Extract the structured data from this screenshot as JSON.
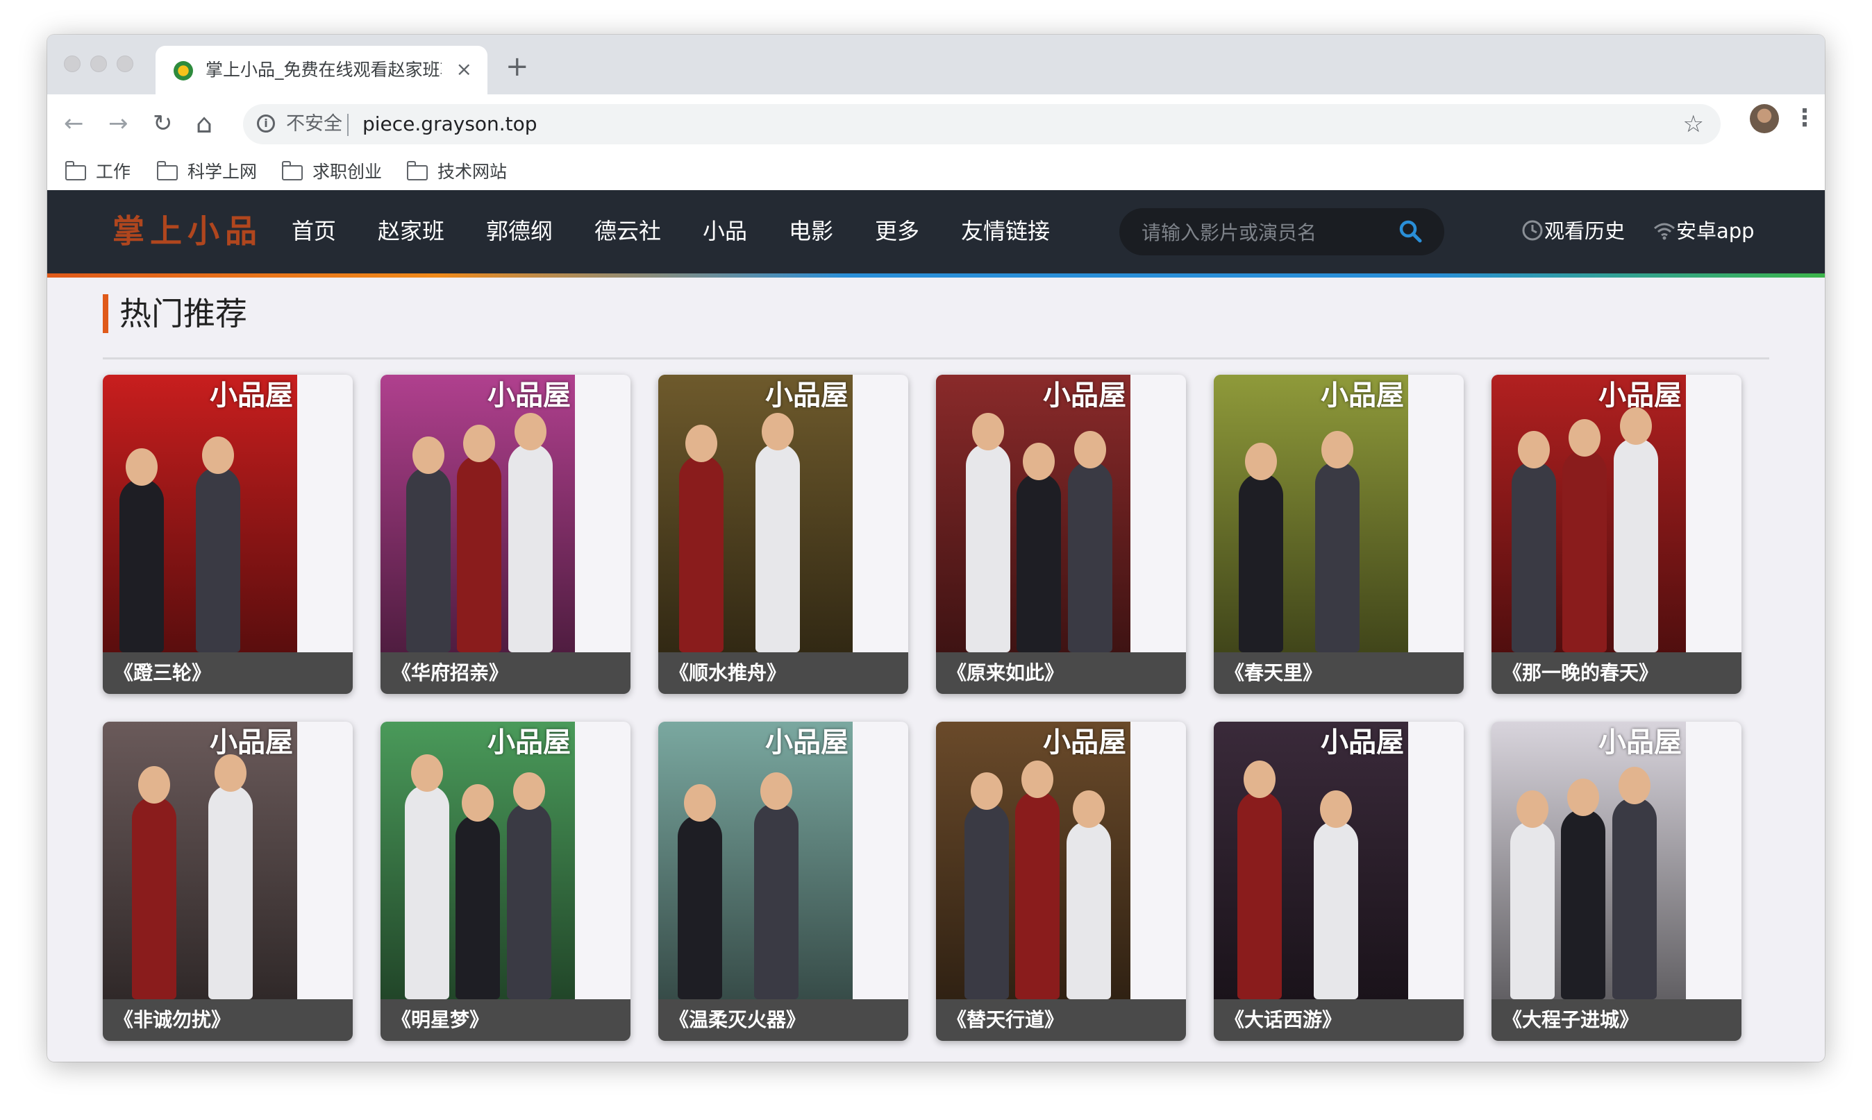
{
  "browser": {
    "tab_title": "掌上小品_免费在线观看赵家班郭",
    "tab_close": "×",
    "new_tab": "+",
    "back": "←",
    "forward": "→",
    "reload": "↻",
    "home": "⌂",
    "security_label": "不安全",
    "url": "piece.grayson.top",
    "bookmark_star": "☆",
    "menu": "⋮",
    "bookmarks": [
      "工作",
      "科学上网",
      "求职创业",
      "技术网站"
    ]
  },
  "site": {
    "logo": "掌上小品",
    "nav": [
      "首页",
      "赵家班",
      "郭德纲",
      "德云社",
      "小品",
      "电影",
      "更多",
      "友情链接"
    ],
    "search_placeholder": "请输入影片或演员名",
    "history_label": "观看历史",
    "android_label": "安卓app",
    "accent_colors": [
      "#e05a1a",
      "#2a8fd8",
      "#3cb54a"
    ]
  },
  "section": {
    "title": "热门推荐"
  },
  "cards": [
    {
      "title": "《蹬三轮》",
      "watermark": "小品屋",
      "bg": "#c81e1e"
    },
    {
      "title": "《华府招亲》",
      "watermark": "小品屋",
      "bg": "#b0408e"
    },
    {
      "title": "《顺水推舟》",
      "watermark": "小品屋",
      "bg": "#6e5a2c"
    },
    {
      "title": "《原来如此》",
      "watermark": "小品屋",
      "bg": "#8a2a2a"
    },
    {
      "title": "《春天里》",
      "watermark": "小品屋",
      "bg": "#8f9a3a"
    },
    {
      "title": "《那一晚的春天》",
      "watermark": "小品屋",
      "bg": "#b22020"
    },
    {
      "title": "《非诚勿扰》",
      "watermark": "小品屋",
      "bg": "#6a5a5a"
    },
    {
      "title": "《明星梦》",
      "watermark": "小品屋",
      "bg": "#4a9a5a"
    },
    {
      "title": "《温柔灭火器》",
      "watermark": "小品屋",
      "bg": "#7aa8a0"
    },
    {
      "title": "《替天行道》",
      "watermark": "小品屋",
      "bg": "#6a4a2a"
    },
    {
      "title": "《大话西游》",
      "watermark": "小品屋",
      "bg": "#3a2a3a"
    },
    {
      "title": "《大程子进城》",
      "watermark": "小品屋",
      "bg": "#d8d4dc"
    }
  ]
}
